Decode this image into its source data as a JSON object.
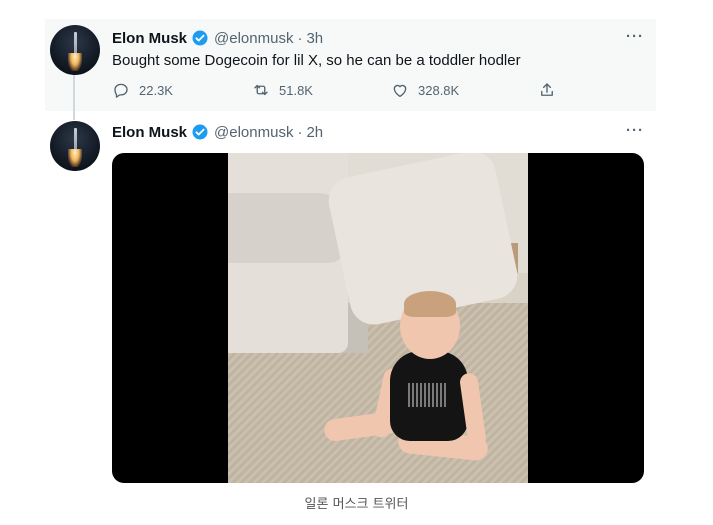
{
  "tweets": [
    {
      "name": "Elon Musk",
      "handle": "@elonmusk",
      "time": "3h",
      "text": "Bought some Dogecoin for lil X, so he can be a toddler hodler",
      "replies": "22.3K",
      "retweets": "51.8K",
      "likes": "328.8K",
      "more": "···"
    },
    {
      "name": "Elon Musk",
      "handle": "@elonmusk",
      "time": "2h",
      "more": "···"
    }
  ],
  "separator": "·",
  "caption": "일론 머스크 트위터",
  "icons": {
    "verified": "verified-badge-icon",
    "reply": "reply-icon",
    "retweet": "retweet-icon",
    "like": "heart-icon",
    "share": "share-icon"
  },
  "colors": {
    "verified": "#1d9bf0",
    "secondary_text": "#536471",
    "highlight_bg": "#f7f9f9"
  }
}
